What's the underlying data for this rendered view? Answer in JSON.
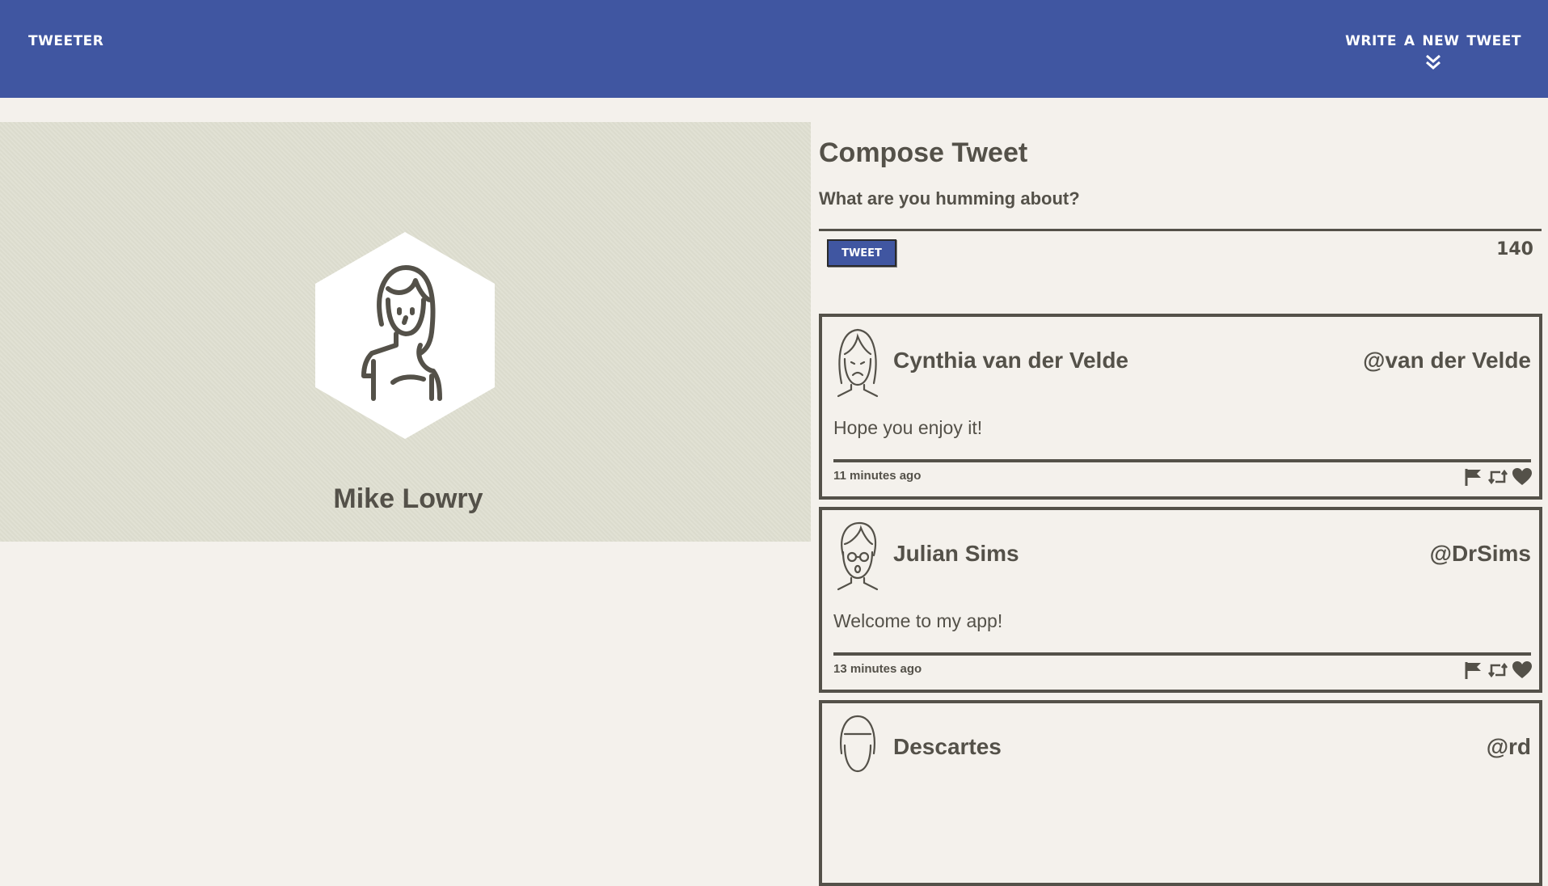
{
  "nav": {
    "brand": "Tweeter",
    "write_new": "Write a new tweet",
    "write_new_icon": "double-chevron-down-icon"
  },
  "profile": {
    "name": "Mike Lowry",
    "avatar_icon": "user-avatar-icon"
  },
  "compose": {
    "title": "Compose Tweet",
    "placeholder": "What are you humming about?",
    "button_label": "Tweet",
    "counter": "140"
  },
  "tweets": [
    {
      "name": "Cynthia van der Velde",
      "handle": "@van der Velde",
      "content": "Hope you enjoy it!",
      "time": "11 minutes ago"
    },
    {
      "name": "Julian Sims",
      "handle": "@DrSims",
      "content": "Welcome to my app!",
      "time": "13 minutes ago"
    },
    {
      "name": "Descartes",
      "handle": "@rd",
      "content": "",
      "time": ""
    }
  ],
  "colors": {
    "header": "#4056a1",
    "text": "#545149",
    "background": "#f4f1ec",
    "profile_bg": "#dfdfd1"
  }
}
